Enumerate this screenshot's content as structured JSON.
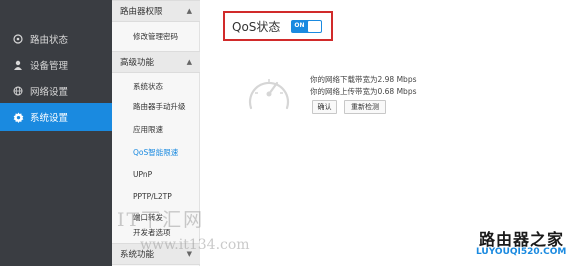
{
  "sidebar": {
    "items": [
      {
        "label": "路由状态",
        "icon": "dashboard-icon"
      },
      {
        "label": "设备管理",
        "icon": "user-icon"
      },
      {
        "label": "网络设置",
        "icon": "globe-icon"
      },
      {
        "label": "系统设置",
        "icon": "gear-icon",
        "active": true
      }
    ]
  },
  "submenu": {
    "group1": {
      "label": "路由器权限",
      "items": [
        "修改管理密码"
      ]
    },
    "group2": {
      "label": "高级功能",
      "items": [
        "系统状态",
        "路由器手动升级",
        "应用限速",
        "QoS智能限速",
        "UPnP",
        "PPTP/L2TP",
        "端口转发",
        "开发者选项"
      ]
    },
    "group3": {
      "label": "系统功能"
    }
  },
  "main": {
    "qos_title": "QoS状态",
    "toggle_label": "ON",
    "download_text": "你的网络下载带宽为2.98 Mbps",
    "upload_text": "你的网络上传带宽为0.68 Mbps",
    "confirm_button": "确认",
    "retest_button": "重新检测"
  },
  "watermarks": {
    "left_brand": "IT下汇网",
    "left_url": "www.it134.com",
    "right_brand": "路由器之家",
    "right_url": "LUYOUQI520.COM"
  },
  "colors": {
    "accent": "#1a8ae0",
    "sidebar_bg": "#3a3d42",
    "highlight_border": "#d12a2a"
  }
}
